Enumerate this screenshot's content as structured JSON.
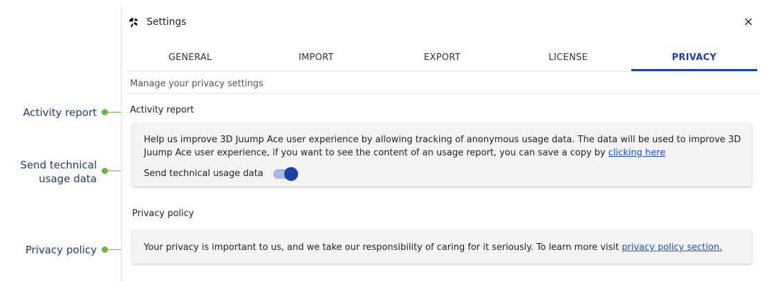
{
  "callouts": {
    "activity_report": "Activity report",
    "send_technical_line1": "Send technical",
    "send_technical_line2": "usage data",
    "privacy_policy": "Privacy policy"
  },
  "window": {
    "title": "Settings",
    "close_icon": "×"
  },
  "tabs": [
    {
      "label": "GENERAL",
      "active": false
    },
    {
      "label": "IMPORT",
      "active": false
    },
    {
      "label": "EXPORT",
      "active": false
    },
    {
      "label": "LICENSE",
      "active": false
    },
    {
      "label": "PRIVACY",
      "active": true
    }
  ],
  "subtitle": "Manage your privacy settings",
  "activity": {
    "heading": "Activity report",
    "text": "Help us improve 3D Juump Ace user experience by allowing tracking of anonymous usage data. The data will be used to improve 3D Juump Ace user experience, if you want to see the content of an usage report, you can save a copy by ",
    "link": "clicking here",
    "toggle_label": "Send technical usage data",
    "toggle_on": true
  },
  "privacy": {
    "heading": "Privacy policy",
    "text": "Your privacy is important to us, and we take our responsibility of caring for it seriously. To learn more visit ",
    "link": "privacy policy section."
  },
  "colors": {
    "accent": "#1d3fa8",
    "callout_text": "#1b3d7a",
    "callout_line": "#6cb33f",
    "link": "#1a4bd6"
  }
}
